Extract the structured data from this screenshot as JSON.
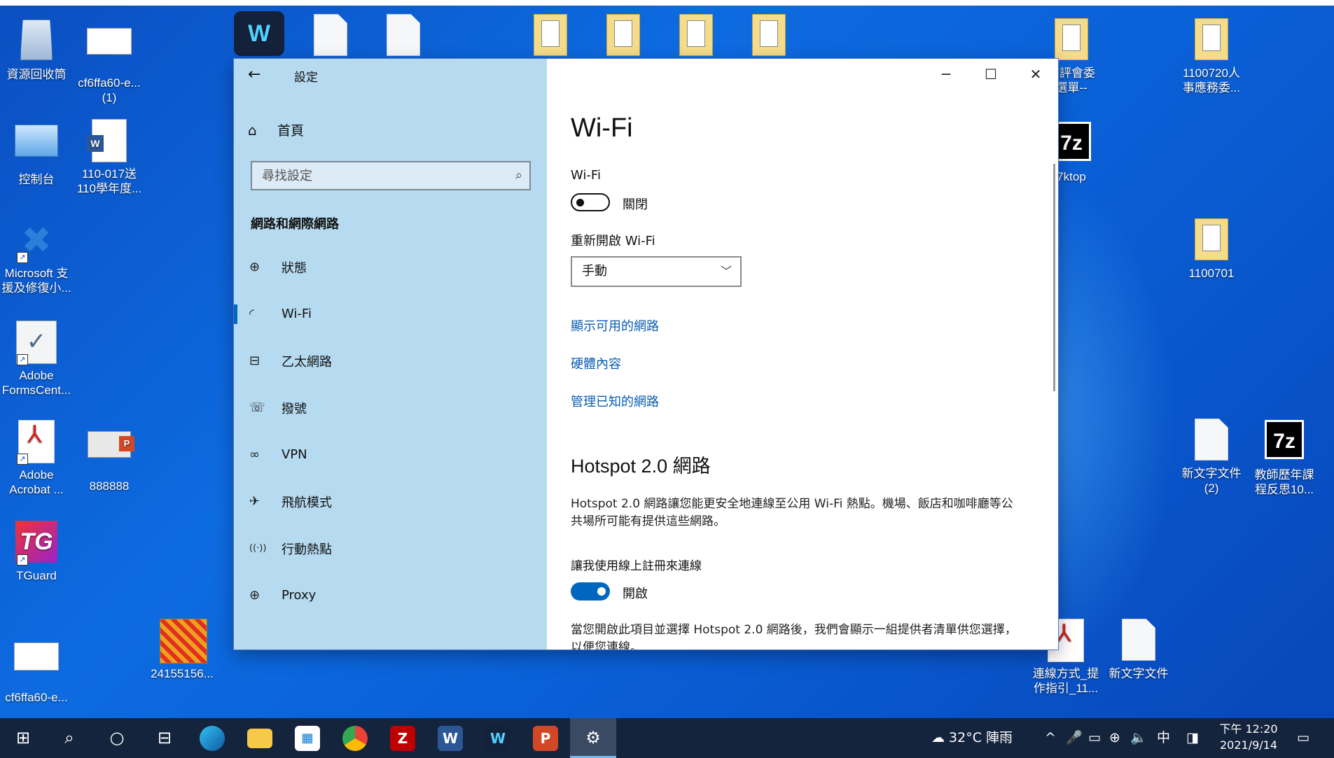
{
  "desktop": {
    "left_icons": [
      {
        "label": "資源回收筒",
        "icon": "recycle-bin-icon"
      },
      {
        "label": "cf6ffa60-e...\n(1)",
        "icon": "image-file-icon"
      },
      {
        "label": "控制台",
        "icon": "control-panel-icon"
      },
      {
        "label": "110-017送\n110學年度...",
        "icon": "word-doc-icon"
      },
      {
        "label": "Microsoft 支\n援及修復小...",
        "icon": "tools-icon"
      },
      {
        "label": "Adobe\nFormsCent...",
        "icon": "adobe-forms-icon"
      },
      {
        "label": "Adobe\nAcrobat ...",
        "icon": "acrobat-icon"
      },
      {
        "label": "888888",
        "icon": "powerpoint-file-icon"
      },
      {
        "label": "TGuard",
        "icon": "tguard-icon"
      },
      {
        "label": "cf6ffa60-e...",
        "icon": "image-file-icon"
      },
      {
        "label": "24155156...",
        "icon": "image-file-icon"
      }
    ],
    "right_icons": [
      {
        "label": "教評會委\n選單--",
        "icon": "pdf-file-icon"
      },
      {
        "label": "1100720人\n事應務委...",
        "icon": "folder-doc-icon"
      },
      {
        "label": "7ktop",
        "icon": "7zip-icon"
      },
      {
        "label": "1100701",
        "icon": "folder-icon"
      },
      {
        "label": "新文字文件\n(2)",
        "icon": "text-file-icon"
      },
      {
        "label": "教師歷年課\n程反思10...",
        "icon": "7zip-icon"
      },
      {
        "label": "連線方式_提\n作指引_11...",
        "icon": "pdf-file-icon"
      },
      {
        "label": "新文字文件",
        "icon": "text-file-icon"
      }
    ]
  },
  "window": {
    "title": "設定",
    "back_icon": "←",
    "controls": {
      "minimize": "─",
      "maximize": "☐",
      "close": "✕"
    },
    "sidebar": {
      "home_label": "首頁",
      "search_placeholder": "尋找設定",
      "section_title": "網路和網際網路",
      "items": [
        {
          "label": "狀態",
          "icon": "globe-status-icon",
          "glyph": "⊕"
        },
        {
          "label": "Wi-Fi",
          "icon": "wifi-icon",
          "glyph": "◜",
          "selected": true
        },
        {
          "label": "乙太網路",
          "icon": "ethernet-icon",
          "glyph": "⊟"
        },
        {
          "label": "撥號",
          "icon": "dialup-icon",
          "glyph": "☏"
        },
        {
          "label": "VPN",
          "icon": "vpn-icon",
          "glyph": "∞"
        },
        {
          "label": "飛航模式",
          "icon": "airplane-icon",
          "glyph": "✈"
        },
        {
          "label": "行動熱點",
          "icon": "hotspot-icon",
          "glyph": "((·))"
        },
        {
          "label": "Proxy",
          "icon": "proxy-globe-icon",
          "glyph": "⊕"
        }
      ]
    },
    "content": {
      "heading": "Wi-Fi",
      "wifi_label": "Wi-Fi",
      "wifi_toggle_state": "關閉",
      "wifi_on": false,
      "reopen_label": "重新開啟 Wi-Fi",
      "reopen_value": "手動",
      "links": [
        "顯示可用的網路",
        "硬體內容",
        "管理已知的網路"
      ],
      "hotspot_heading": "Hotspot 2.0 網路",
      "hotspot_desc": "Hotspot 2.0 網路讓您能更安全地連線至公用 Wi-Fi 熱點。機場、飯店和咖啡廳等公共場所可能有提供這些網路。",
      "online_signup_label": "讓我使用線上註冊來連線",
      "online_signup_state": "開啟",
      "online_signup_on": true,
      "footer_desc": "當您開啟此項目並選擇 Hotspot 2.0 網路後，我們會顯示一組提供者清單供您選擇，以便您連線。"
    }
  },
  "taskbar": {
    "weather": "32°C 陣雨",
    "ime": "中",
    "time": "下午 12:20",
    "date": "2021/9/14",
    "apps": [
      "start-icon",
      "search-icon",
      "cortana-icon",
      "task-view-icon",
      "edge-icon",
      "file-explorer-icon",
      "store-icon",
      "chrome-icon",
      "filezilla-icon",
      "word-icon",
      "webex-icon",
      "powerpoint-icon",
      "settings-gear-icon"
    ]
  },
  "colors": {
    "accent": "#0067c0",
    "sidebar": "#b6daf0",
    "link": "#0a5db0",
    "taskbar": "#15243d"
  }
}
